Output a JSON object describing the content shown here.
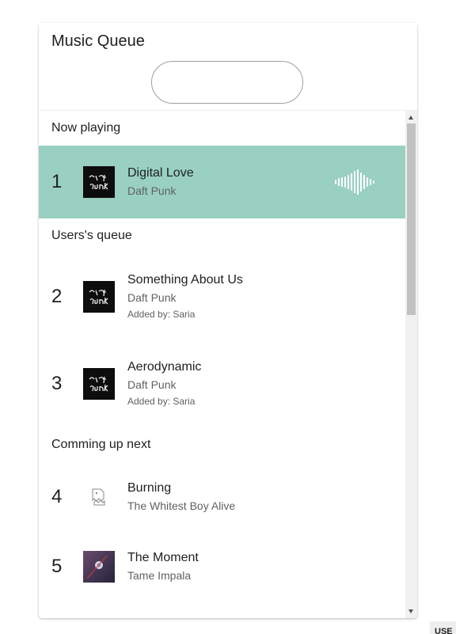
{
  "title": "Music Queue",
  "search": {
    "placeholder": "",
    "value": ""
  },
  "colors": {
    "now_playing_bg": "#99d0c1",
    "scrollbar_thumb": "#c1c1c1"
  },
  "sections": {
    "now_playing": "Now playing",
    "users_queue": "Users's queue",
    "coming_up": "Comming up next"
  },
  "now_playing": {
    "number": "1",
    "song": "Digital Love",
    "artist": "Daft Punk",
    "icon": "audio-wave-icon"
  },
  "users_queue": [
    {
      "number": "2",
      "song": "Something About Us",
      "artist": "Daft Punk",
      "added_by": "Added by: Saria"
    },
    {
      "number": "3",
      "song": "Aerodynamic",
      "artist": "Daft Punk",
      "added_by": "Added by: Saria"
    }
  ],
  "coming_up": [
    {
      "number": "4",
      "song": "Burning",
      "artist": "The Whitest Boy Alive"
    },
    {
      "number": "5",
      "song": "The Moment",
      "artist": "Tame Impala"
    }
  ],
  "corner_tab": "USE"
}
